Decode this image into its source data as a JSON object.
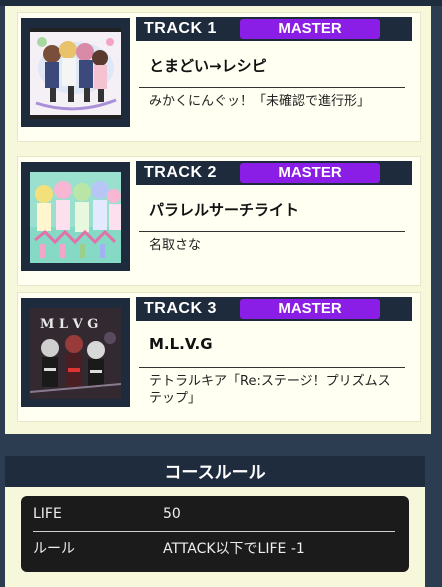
{
  "tracks": [
    {
      "number_label": "TRACK 1",
      "difficulty": "MASTER",
      "title": "とまどい→レシピ",
      "artist": "みかくにんぐッ！「未確認で進行形」",
      "jacket_icon": "album-art-group-of-girls"
    },
    {
      "number_label": "TRACK 2",
      "difficulty": "MASTER",
      "title": "パラレルサーチライト",
      "artist": "名取さな",
      "jacket_icon": "album-art-pastel-characters"
    },
    {
      "number_label": "TRACK 3",
      "difficulty": "MASTER",
      "title": "M.L.V.G",
      "artist": "テトラルキア「Re:ステージ！プリズムステップ」",
      "jacket_icon": "album-art-dark-gothic"
    }
  ],
  "course_rules": {
    "heading": "コースルール",
    "rows": [
      {
        "key": "LIFE",
        "value": "50"
      },
      {
        "key": "ルール",
        "value": "ATTACK以下でLIFE -1"
      }
    ]
  },
  "colors": {
    "page_background": "#2c3d52",
    "panel_background": "#f7f7dc",
    "header_navy": "#1e2b3c",
    "master_purple": "#8a1ee6",
    "rules_table": "#1b1b1b"
  }
}
